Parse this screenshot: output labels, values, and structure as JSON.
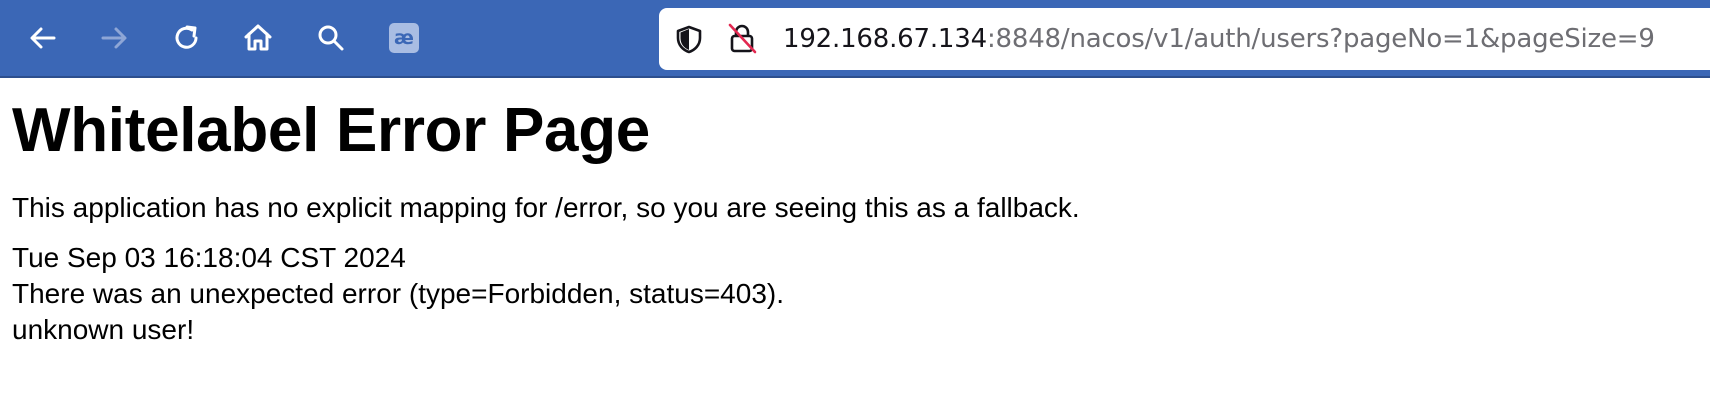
{
  "browser": {
    "toolbar_color": "#3b67b6",
    "back_icon": "arrow-left-icon",
    "forward_icon": "arrow-right-icon",
    "reload_icon": "reload-icon",
    "home_icon": "home-icon",
    "search_icon": "search-icon",
    "extension_icon": "extension-icon",
    "extension_glyph": "æ",
    "address_bar": {
      "host": "192.168.67.134",
      "rest": ":8848/nacos/v1/auth/users?pageNo=1&pageSize=9",
      "shield_icon": "shield-icon",
      "insecure_lock_icon": "insecure-lock-icon"
    }
  },
  "page": {
    "title": "Whitelabel Error Page",
    "message": "This application has no explicit mapping for /error, so you are seeing this as a fallback.",
    "timestamp": "Tue Sep 03 16:18:04 CST 2024",
    "error_line": "There was an unexpected error (type=Forbidden, status=403).",
    "detail": "unknown user!"
  }
}
